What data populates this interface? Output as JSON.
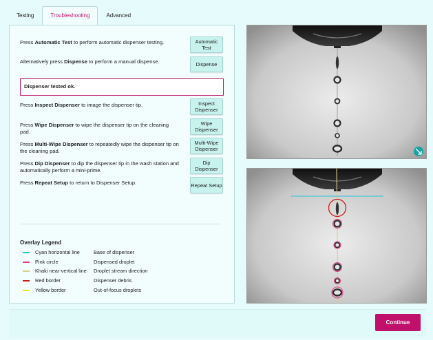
{
  "tabs": [
    {
      "label": "Testing"
    },
    {
      "label": "Troubleshooting"
    },
    {
      "label": "Advanced"
    }
  ],
  "rows": [
    {
      "pre": "Press ",
      "bold": "Automatic Test",
      "post": " to perform automatic dispenser testing.",
      "button": "Automatic Test"
    },
    {
      "pre": "Alternatively press ",
      "bold": "Dispense",
      "post": " to perform a manual dispense.",
      "button": "Dispense"
    },
    {
      "pre": "Press ",
      "bold": "Inspect Dispenser",
      "post": " to image the dispenser tip.",
      "button": "Inspect Dispenser"
    },
    {
      "pre": "Press ",
      "bold": "Wipe Dispenser",
      "post": " to wipe the dispenser tip on the cleaning pad.",
      "button": "Wipe Dispenser"
    },
    {
      "pre": "Press ",
      "bold": "Multi-Wipe Dispenser",
      "post": " to repeatedly wipe the dispenser tip on the cleaning pad.",
      "button": "Multi-Wipe Dispenser"
    },
    {
      "pre": "Press ",
      "bold": "Dip Dispenser",
      "post": " to dip the dispenser tip in the wash station and automatically perform a mini-prime.",
      "button": "Dip Dispenser"
    },
    {
      "pre": "Press ",
      "bold": "Repeat Setup",
      "post": "  to return to Dispenser Setup.",
      "button": "Repeat Setup"
    }
  ],
  "status_message": "Dispenser tested ok.",
  "legend": {
    "title": "Overlay Legend",
    "items": [
      {
        "label": "Cyan horizontal line",
        "desc": "Base of dispenser",
        "color": "#27c7d6"
      },
      {
        "label": "Pink circle",
        "desc": "Dispensed droplet",
        "color": "#e0408a"
      },
      {
        "label": "Khaki near-vertical line",
        "desc": "Droplet stream direction",
        "color": "#d8cf88"
      },
      {
        "label": "Red border",
        "desc": "Dispenser debris",
        "color": "#d01818"
      },
      {
        "label": "Yellow border",
        "desc": "Out-of-focus droplets",
        "color": "#f0e030"
      }
    ]
  },
  "icons": {
    "expand": "expand-diagonal-icon"
  },
  "continue_label": "Continue",
  "colors": {
    "accent": "#c0106c",
    "button_bg": "#c8f2ee",
    "page_bg": "#e6fbfb"
  }
}
